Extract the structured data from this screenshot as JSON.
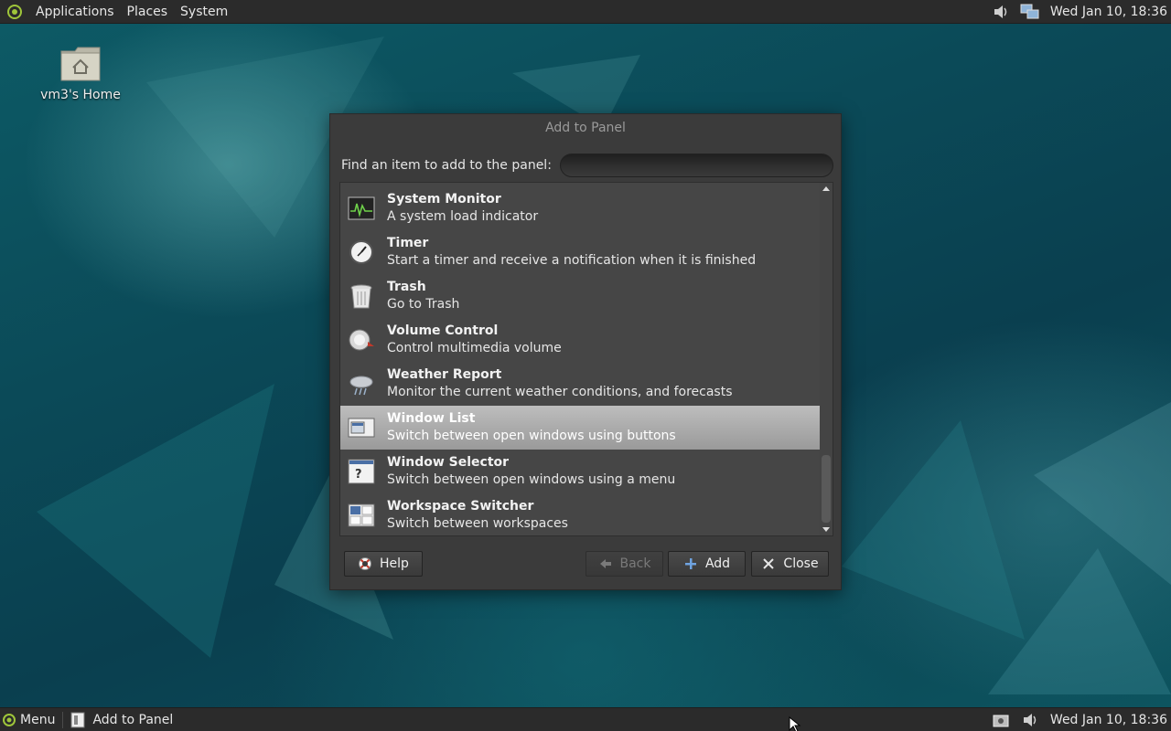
{
  "top_panel": {
    "menus": [
      "Applications",
      "Places",
      "System"
    ],
    "clock": "Wed Jan 10, 18:36"
  },
  "desktop": {
    "home_icon_label": "vm3's Home"
  },
  "dialog": {
    "title": "Add to Panel",
    "find_label": "Find an item to add to the panel:",
    "find_value": "",
    "items": [
      {
        "name": "System Monitor",
        "desc": "A system load indicator",
        "icon": "system-monitor-icon",
        "selected": false
      },
      {
        "name": "Timer",
        "desc": "Start a timer and receive a notification when it is finished",
        "icon": "timer-icon",
        "selected": false
      },
      {
        "name": "Trash",
        "desc": "Go to Trash",
        "icon": "trash-icon",
        "selected": false
      },
      {
        "name": "Volume Control",
        "desc": "Control multimedia volume",
        "icon": "volume-control-icon",
        "selected": false
      },
      {
        "name": "Weather Report",
        "desc": "Monitor the current weather conditions, and forecasts",
        "icon": "weather-icon",
        "selected": false
      },
      {
        "name": "Window List",
        "desc": "Switch between open windows using buttons",
        "icon": "window-list-icon",
        "selected": true
      },
      {
        "name": "Window Selector",
        "desc": "Switch between open windows using a menu",
        "icon": "window-selector-icon",
        "selected": false
      },
      {
        "name": "Workspace Switcher",
        "desc": "Switch between workspaces",
        "icon": "workspace-switcher-icon",
        "selected": false
      }
    ],
    "buttons": {
      "help": "Help",
      "back": "Back",
      "add": "Add",
      "close": "Close"
    }
  },
  "bottom_panel": {
    "menu_label": "Menu",
    "taskbar_item": "Add to Panel",
    "clock": "Wed Jan 10, 18:36"
  },
  "colors": {
    "panel_bg": "#2b2b2b",
    "dialog_bg": "#3b3b3b",
    "list_bg": "#464646",
    "selection": "#b0b0b0",
    "wallpaper": "#0e4a57"
  }
}
